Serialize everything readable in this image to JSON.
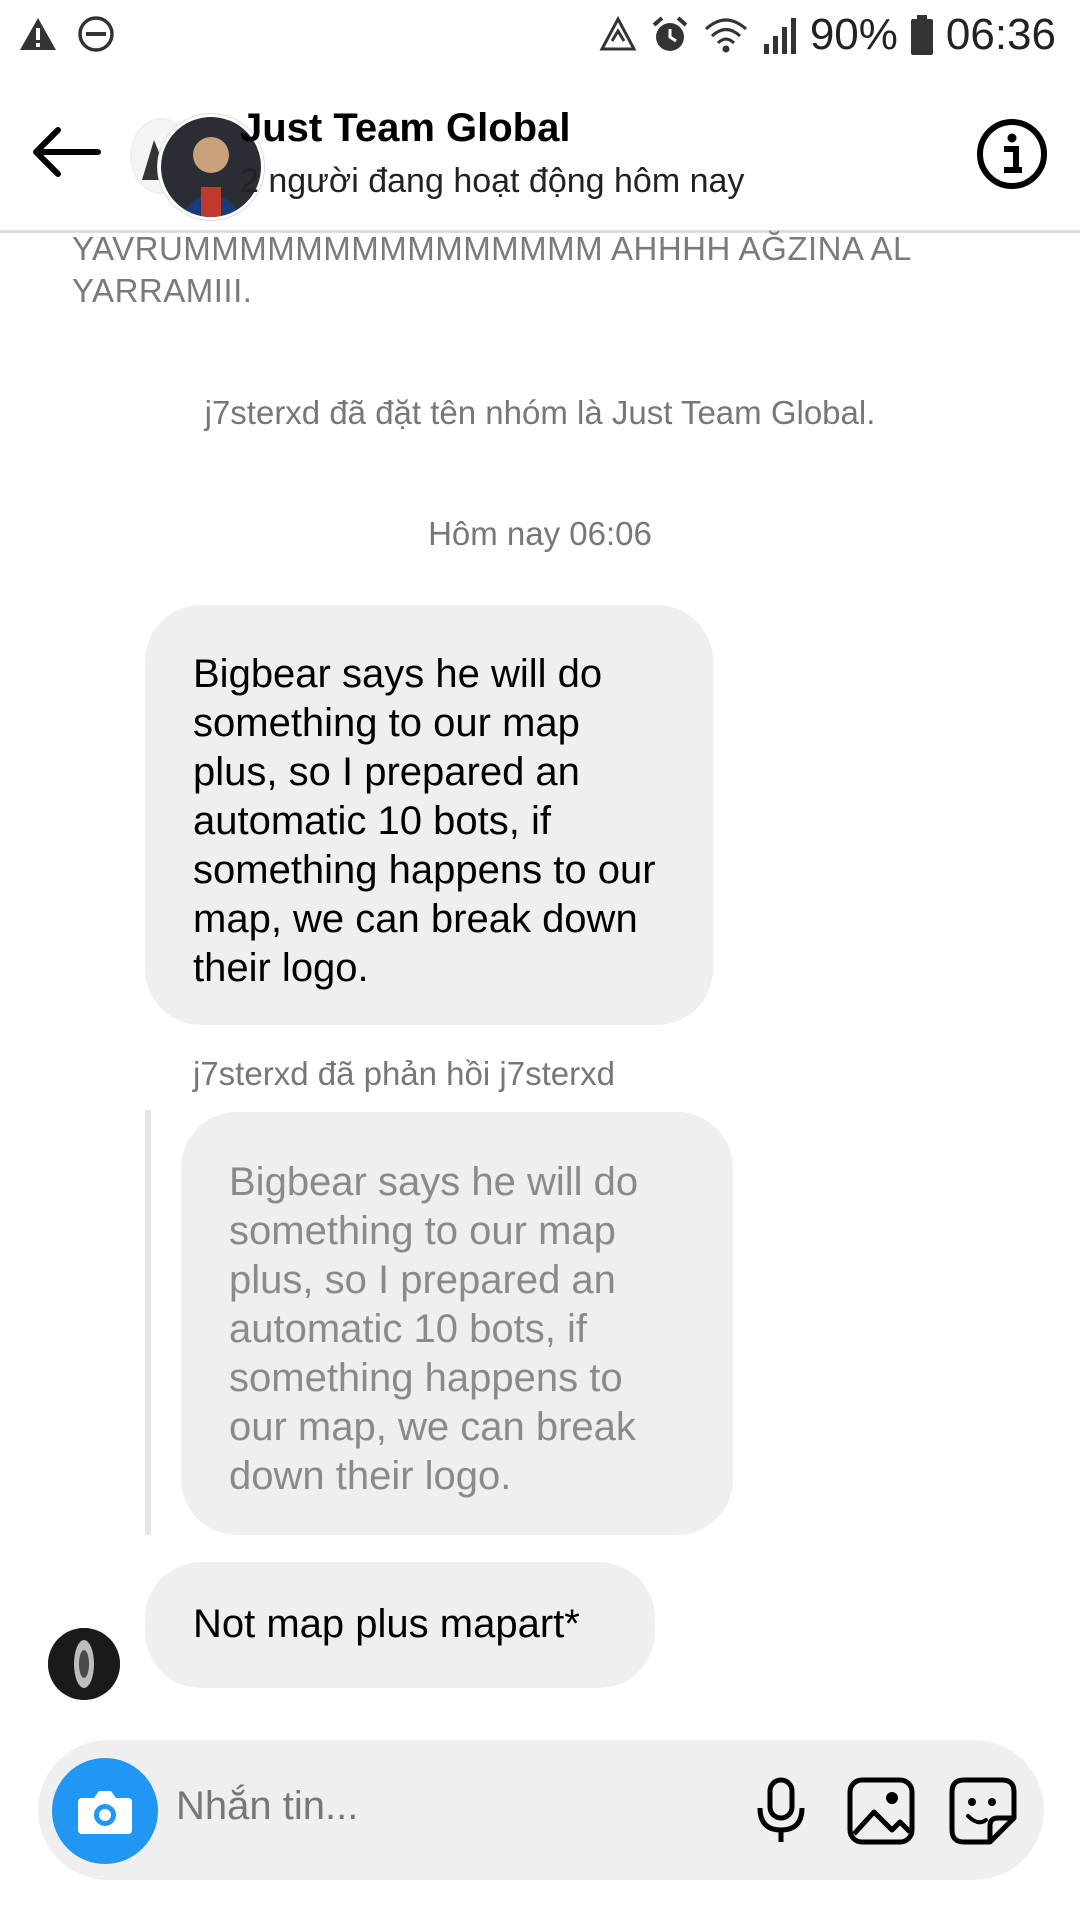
{
  "status_bar": {
    "battery": "90%",
    "time": "06:36"
  },
  "header": {
    "title": "Just Team Global",
    "subtitle": "2 người đang hoạt động hôm nay"
  },
  "chat": {
    "partial_message": "YAVRUMMMMMMMMMMMMMMM AHHHH AĞZINA AL YARRAMIII.",
    "system_rename": "j7sterxd đã đặt tên nhóm là Just Team Global.",
    "timestamp": "Hôm nay 06:06",
    "message_1": "Bigbear says he will do something to our map plus, so I prepared an automatic 10 bots, if something happens to our map, we can break down their logo.",
    "reply_label": "j7sterxd đã phản hồi j7sterxd",
    "quoted_message": "Bigbear says he will do something to our map plus, so I prepared an automatic 10 bots, if something happens to our map, we can break down their logo.",
    "message_2": "Not map plus mapart*"
  },
  "composer": {
    "placeholder": "Nhắn tin..."
  },
  "icons": {
    "warning": "warning-icon",
    "dnd": "do-not-disturb-icon",
    "back": "back-arrow-icon",
    "info": "info-icon",
    "camera": "camera-icon",
    "mic": "microphone-icon",
    "gallery": "gallery-icon",
    "sticker": "sticker-icon"
  },
  "colors": {
    "accent": "#2196f3",
    "bubble": "#efefef"
  }
}
